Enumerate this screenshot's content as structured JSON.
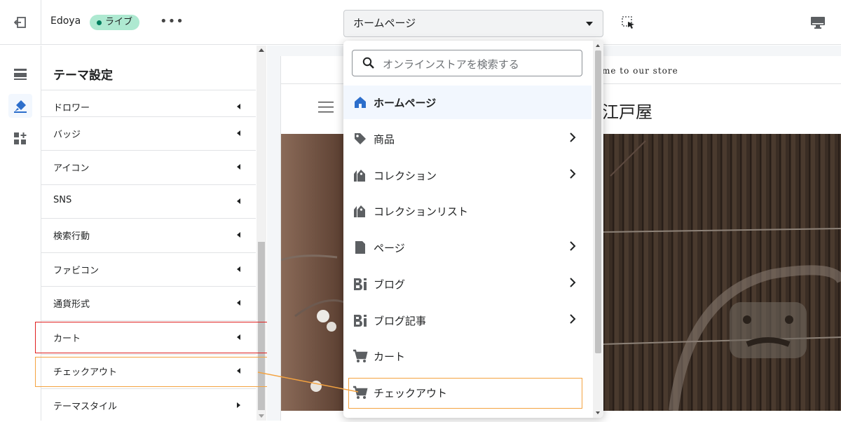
{
  "topbar": {
    "store_name": "Edoya",
    "live_label": "ライブ",
    "more_label": "•••",
    "page_select_value": "ホームページ"
  },
  "panel": {
    "title": "テーマ設定",
    "settings": [
      {
        "label": "ドロワー"
      },
      {
        "label": "バッジ"
      },
      {
        "label": "アイコン"
      },
      {
        "label": "SNS"
      },
      {
        "label": "検索行動"
      },
      {
        "label": "ファビコン"
      },
      {
        "label": "通貨形式"
      },
      {
        "label": "カート"
      },
      {
        "label": "チェックアウト"
      },
      {
        "label": "テーマスタイル"
      }
    ]
  },
  "preview": {
    "announcement": "me to our store",
    "logo": "江戸屋"
  },
  "dropdown": {
    "search_placeholder": "オンラインストアを検索する",
    "items": [
      {
        "label": "ホームページ",
        "icon": "home-icon",
        "selected": true,
        "has_submenu": false
      },
      {
        "label": "商品",
        "icon": "tag-icon",
        "selected": false,
        "has_submenu": true
      },
      {
        "label": "コレクション",
        "icon": "collection-icon",
        "selected": false,
        "has_submenu": true
      },
      {
        "label": "コレクションリスト",
        "icon": "collection-icon",
        "selected": false,
        "has_submenu": false
      },
      {
        "label": "ページ",
        "icon": "page-icon",
        "selected": false,
        "has_submenu": true
      },
      {
        "label": "ブログ",
        "icon": "blog-icon",
        "selected": false,
        "has_submenu": true
      },
      {
        "label": "ブログ記事",
        "icon": "blog-icon",
        "selected": false,
        "has_submenu": true
      },
      {
        "label": "カート",
        "icon": "cart-icon",
        "selected": false,
        "has_submenu": false
      },
      {
        "label": "チェックアウト",
        "icon": "cart-icon",
        "selected": false,
        "has_submenu": false
      }
    ]
  },
  "colors": {
    "accent": "#2c6ecb",
    "live_badge": "#aee9d1",
    "highlight_red": "#e02020",
    "highlight_orange": "#f4a340"
  }
}
